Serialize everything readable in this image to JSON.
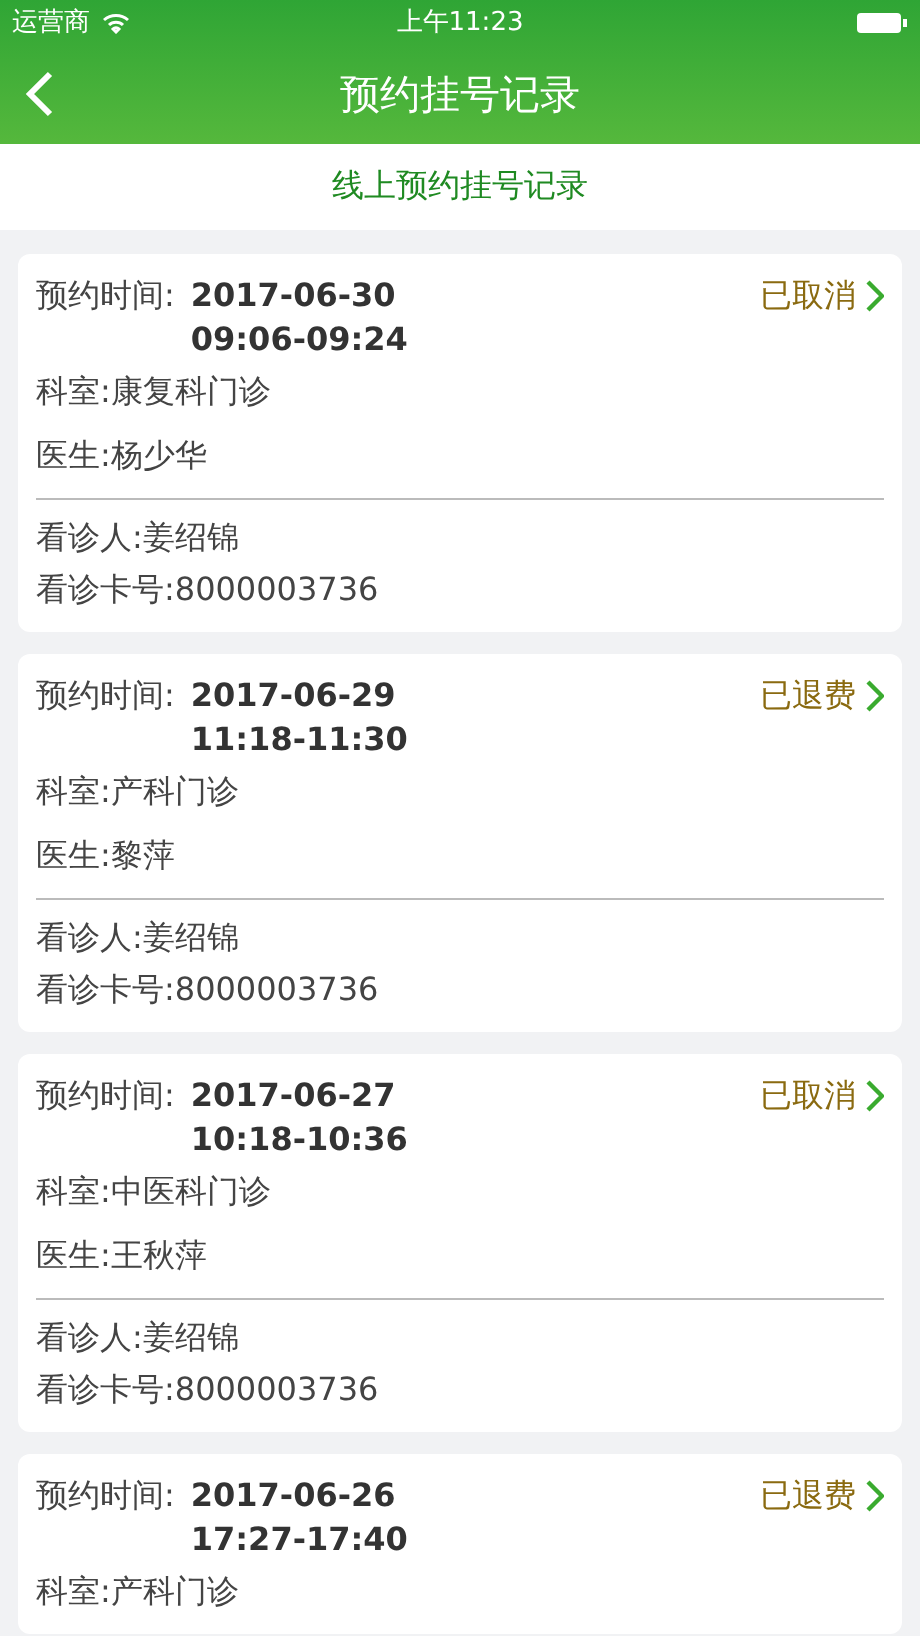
{
  "status_bar": {
    "carrier": "运营商",
    "time": "上午11:23"
  },
  "nav": {
    "title": "预约挂号记录"
  },
  "section_title": "线上预约挂号记录",
  "records": [
    {
      "time_label": "预约时间:",
      "date": "2017-06-30",
      "time_range": "09:06-09:24",
      "status": "已取消",
      "department": "科室:康复科门诊",
      "doctor": "医生:杨少华",
      "patient": "看诊人:姜绍锦",
      "card_no": "看诊卡号:8000003736"
    },
    {
      "time_label": "预约时间:",
      "date": "2017-06-29",
      "time_range": "11:18-11:30",
      "status": "已退费",
      "department": "科室:产科门诊",
      "doctor": "医生:黎萍",
      "patient": "看诊人:姜绍锦",
      "card_no": "看诊卡号:8000003736"
    },
    {
      "time_label": "预约时间:",
      "date": "2017-06-27",
      "time_range": "10:18-10:36",
      "status": "已取消",
      "department": "科室:中医科门诊",
      "doctor": "医生:王秋萍",
      "patient": "看诊人:姜绍锦",
      "card_no": "看诊卡号:8000003736"
    },
    {
      "time_label": "预约时间:",
      "date": "2017-06-26",
      "time_range": "17:27-17:40",
      "status": "已退费",
      "department": "科室:产科门诊"
    }
  ]
}
